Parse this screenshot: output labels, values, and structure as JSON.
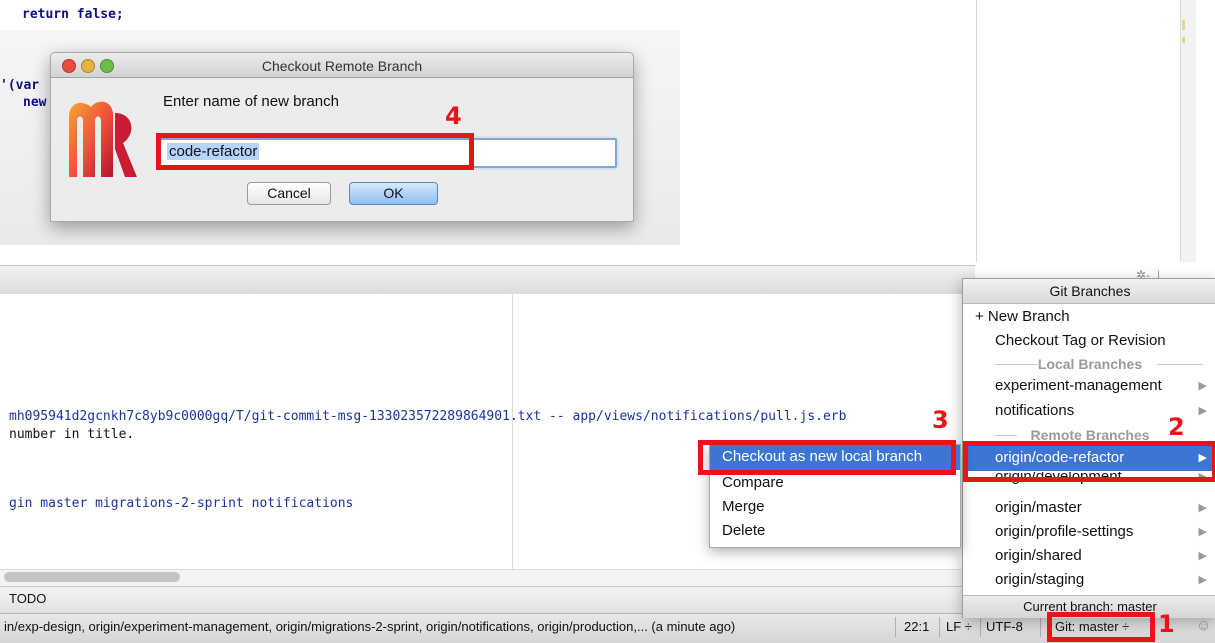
{
  "editor": {
    "code_lines": [
      "return false;",
      "'(var",
      "new"
    ]
  },
  "dialog": {
    "title": "Checkout Remote Branch",
    "prompt": "Enter name of new branch",
    "branch_name": "code-refactor",
    "cancel_label": "Cancel",
    "ok_label": "OK"
  },
  "log": {
    "line1": "mh095941d2gcnkh7c8yb9c0000gq/T/git-commit-msg-133023572289864901.txt -- app/views/notifications/pull.js.erb",
    "line2": "number in title.",
    "line3": "gin master migrations-2-sprint notifications"
  },
  "todo_label": "TODO",
  "status_bar": {
    "message": "in/exp-design, origin/experiment-management, origin/migrations-2-sprint, origin/notifications, origin/production,... (a minute ago)",
    "position": "22:1",
    "line_separator": "LF ÷",
    "encoding": "UTF-8",
    "git_branch": "Git: master ÷"
  },
  "git_popup": {
    "title": "Git Branches",
    "new_branch": "+ New Branch",
    "checkout_tag": "Checkout Tag or Revision",
    "local_header": "Local Branches",
    "local_branches": [
      "experiment-management",
      "notifications"
    ],
    "remote_header": "Remote Branches",
    "remote_branches": [
      "origin/code-refactor",
      "origin/development",
      "origin/master",
      "origin/profile-settings",
      "origin/shared",
      "origin/staging"
    ],
    "current_branch": "Current branch: master"
  },
  "context_menu": {
    "items": [
      "Checkout as new local branch",
      "Compare",
      "Merge",
      "Delete"
    ]
  },
  "annotations": {
    "step1": "1",
    "step2": "2",
    "step3": "3",
    "step4": "4"
  },
  "colors": {
    "annotation_red": "#e8141a",
    "selection_blue": "#3c75d6"
  }
}
